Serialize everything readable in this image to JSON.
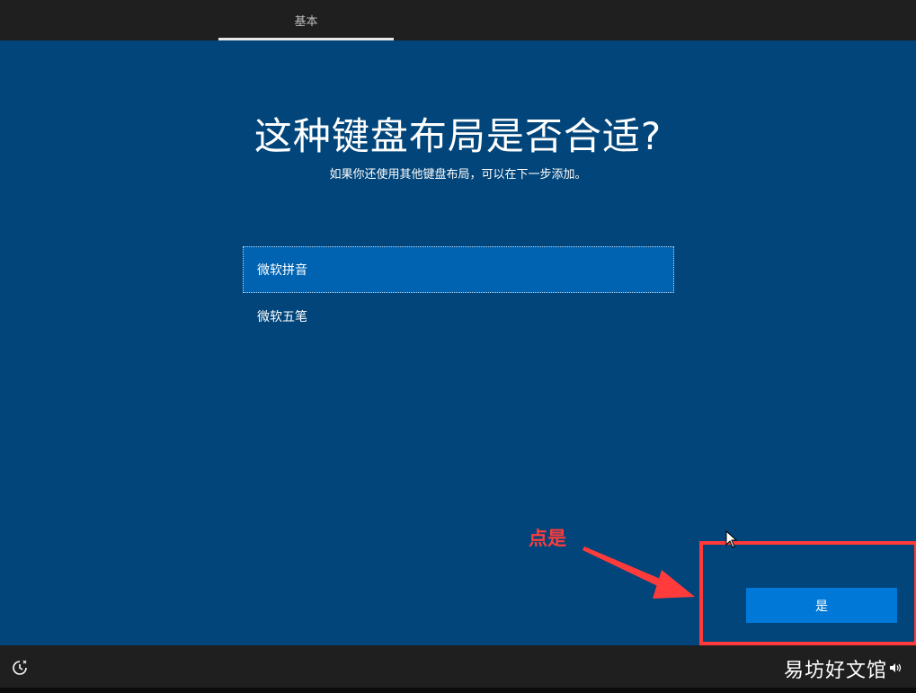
{
  "header": {
    "tabs": [
      {
        "label": "基本",
        "active": true
      }
    ]
  },
  "main": {
    "title": "这种键盘布局是否合适?",
    "subtitle": "如果你还使用其他键盘布局，可以在下一步添加。",
    "options": [
      {
        "label": "微软拼音",
        "selected": true
      },
      {
        "label": "微软五笔",
        "selected": false
      }
    ]
  },
  "annotation": {
    "text": "点是",
    "color": "#ff3b3b"
  },
  "footer": {
    "yes_label": "是",
    "watermark": "易坊好文馆",
    "icons": [
      "accessibility-icon",
      "volume-icon"
    ]
  },
  "colors": {
    "background": "#01457a",
    "bar": "#1f1f1f",
    "selected_item": "#0063b1",
    "button": "#0078d7",
    "highlight": "#ff3a3a"
  }
}
